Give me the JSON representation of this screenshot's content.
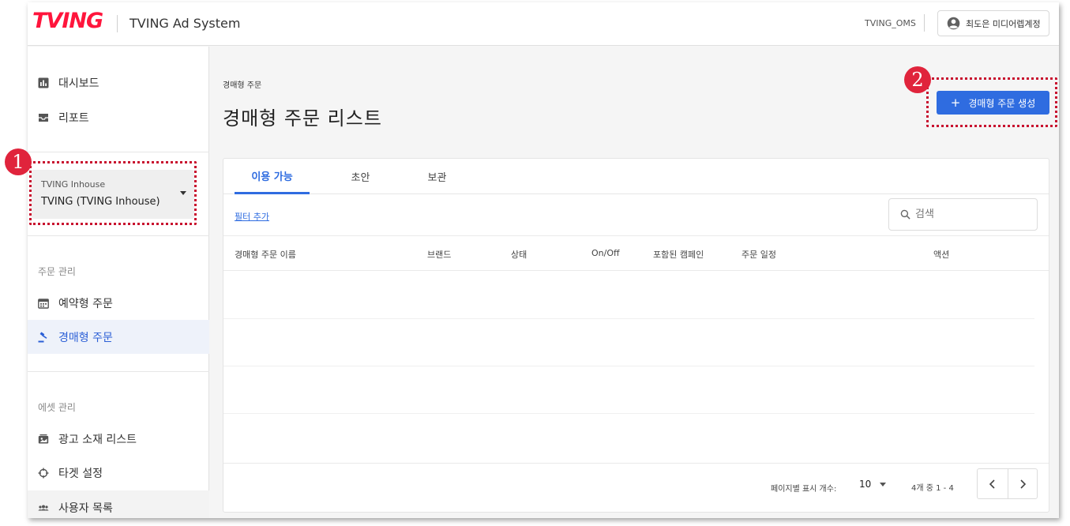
{
  "header": {
    "logo": "TVING",
    "app_title": "TVING Ad System",
    "account_name": "TVING_OMS",
    "user_name": "최도은 미디어렙계정"
  },
  "sidebar": {
    "top_items": [
      {
        "label": "대시보드",
        "icon": "bar-chart-icon"
      },
      {
        "label": "리포트",
        "icon": "inbox-icon"
      }
    ],
    "selector": {
      "small_label": "TVING Inhouse",
      "value": "TVING (TVING Inhouse)"
    },
    "order_section_label": "주문 관리",
    "order_items": [
      {
        "label": "예약형 주문",
        "icon": "calendar-icon"
      },
      {
        "label": "경매형 주문",
        "icon": "gavel-icon",
        "active": true
      }
    ],
    "asset_section_label": "에셋 관리",
    "asset_items": [
      {
        "label": "광고 소재 리스트",
        "icon": "media-icon"
      },
      {
        "label": "타겟 설정",
        "icon": "crosshair-icon"
      },
      {
        "label": "사용자 목록",
        "icon": "users-icon"
      }
    ]
  },
  "annotations": [
    "1",
    "2"
  ],
  "main": {
    "breadcrumb": "경매형 주문",
    "title": "경매형 주문 리스트",
    "create_button": "경매형 주문 생성",
    "tabs": [
      "이용 가능",
      "초안",
      "보관"
    ],
    "filter_link": "필터 추가",
    "search_placeholder": "검색",
    "columns": [
      "경매형 주문 이름",
      "브랜드",
      "상태",
      "On/Off",
      "포함된 캠페인",
      "주문 일정",
      "액션"
    ],
    "pagination": {
      "per_page_label": "페이지별 표시 개수:",
      "per_page": "10",
      "range": "4개 중 1 - 4"
    }
  },
  "colors": {
    "accent": "#2f6ce0",
    "brand": "#ff153c",
    "annotation": "#e0243c"
  }
}
